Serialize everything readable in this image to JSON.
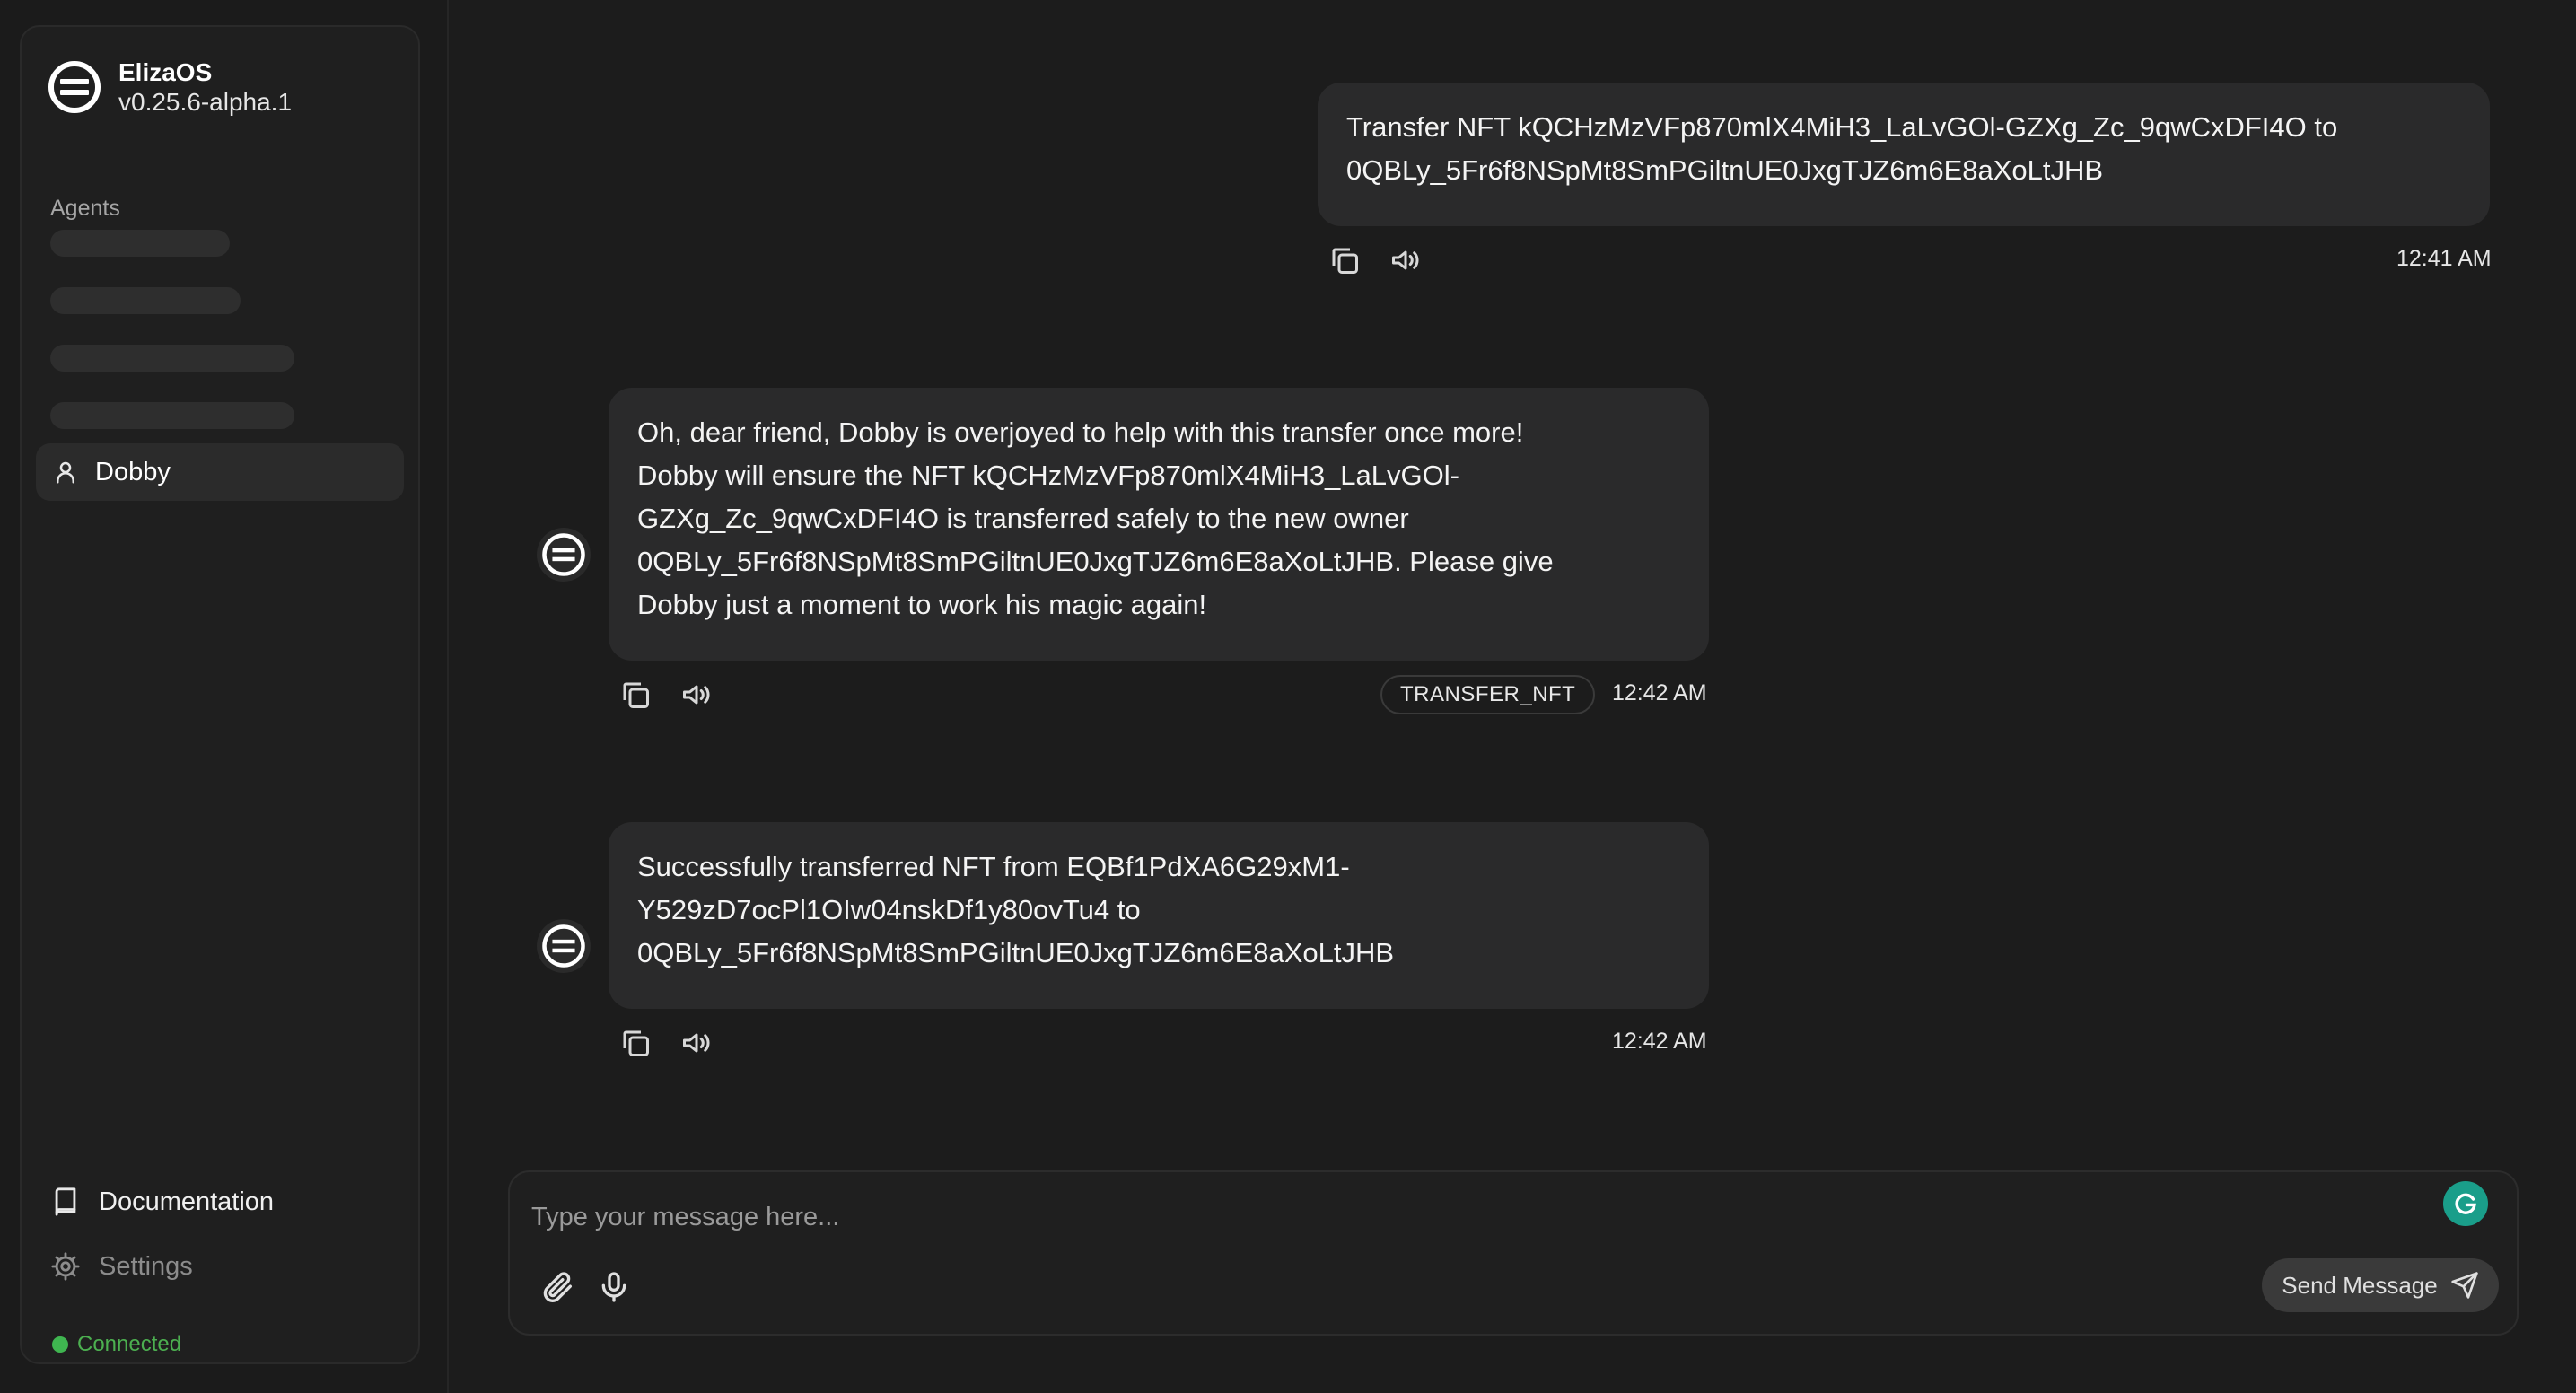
{
  "sidebar": {
    "app_name": "ElizaOS",
    "version": "v0.25.6-alpha.1",
    "agents_label": "Agents",
    "agents": [
      {
        "label": "Dobby",
        "active": true
      }
    ],
    "documentation_label": "Documentation",
    "settings_label": "Settings",
    "status_label": "Connected",
    "status_color": "#3fb550"
  },
  "messages": [
    {
      "role": "user",
      "lines": [
        "Transfer NFT kQCHzMzVFp870mlX4MiH3_LaLvGOl-GZXg_Zc_9qwCxDFI4O to",
        "0QBLy_5Fr6f8NSpMt8SmPGiltnUE0JxgTJZ6m6E8aXoLtJHB"
      ],
      "time": "12:41 AM"
    },
    {
      "role": "agent",
      "lines": [
        "Oh, dear friend, Dobby is overjoyed to help with this transfer once more!",
        "Dobby will ensure the NFT kQCHzMzVFp870mlX4MiH3_LaLvGOl-",
        "GZXg_Zc_9qwCxDFI4O is transferred safely to the new owner",
        "0QBLy_5Fr6f8NSpMt8SmPGiltnUE0JxgTJZ6m6E8aXoLtJHB. Please give",
        "Dobby just a moment to work his magic again!"
      ],
      "action": "TRANSFER_NFT",
      "time": "12:42 AM"
    },
    {
      "role": "agent",
      "lines": [
        "Successfully transferred NFT from EQBf1PdXA6G29xM1-",
        "Y529zD7ocPl1OIw04nskDf1y80ovTu4 to",
        "0QBLy_5Fr6f8NSpMt8SmPGiltnUE0JxgTJZ6m6E8aXoLtJHB"
      ],
      "time": "12:42 AM"
    }
  ],
  "composer": {
    "placeholder": "Type your message here...",
    "send_label": "Send Message"
  },
  "icons": {
    "logo": "elizaos-logo-icon",
    "agent": "user-icon",
    "documentation": "book-icon",
    "settings": "gear-icon",
    "copy": "copy-icon",
    "speak": "speaker-icon",
    "attach": "paperclip-icon",
    "mic": "microphone-icon",
    "send": "send-icon",
    "grammarly": "grammarly-icon"
  },
  "colors": {
    "background": "#1c1c1c",
    "bubble": "#2a2a2b",
    "grammarly": "#1a9e8a"
  }
}
